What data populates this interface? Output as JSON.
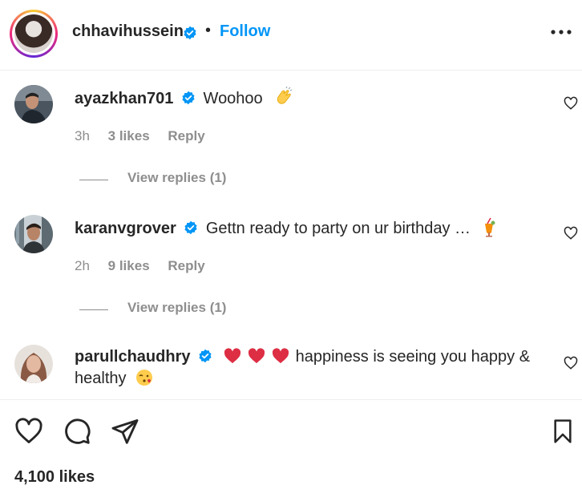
{
  "post": {
    "username": "chhavihussein",
    "separator": "•",
    "follow_label": "Follow",
    "more_icon": "more-options-icon"
  },
  "comments": [
    {
      "username": "ayazkhan701",
      "text": "Woohoo",
      "emoji": "clapping-hands-emoji",
      "time": "3h",
      "likes": "3 likes",
      "reply": "Reply",
      "view_replies": "View replies (1)"
    },
    {
      "username": "karanvgrover",
      "text": "Gettn ready to party on ur birthday …",
      "emoji": "tropical-drink-emoji",
      "time": "2h",
      "likes": "9 likes",
      "reply": "Reply",
      "view_replies": "View replies (1)"
    },
    {
      "username": "parullchaudhry",
      "text": "happiness is seeing you happy & healthy",
      "emoji": "face-blowing-kiss-emoji"
    }
  ],
  "footer": {
    "likes_total": "4,100 likes"
  },
  "colors": {
    "link_blue": "#0095f6",
    "verified_blue": "#0095f6",
    "muted_gray": "#8e8e8e",
    "heart_red": "#ed4956"
  }
}
